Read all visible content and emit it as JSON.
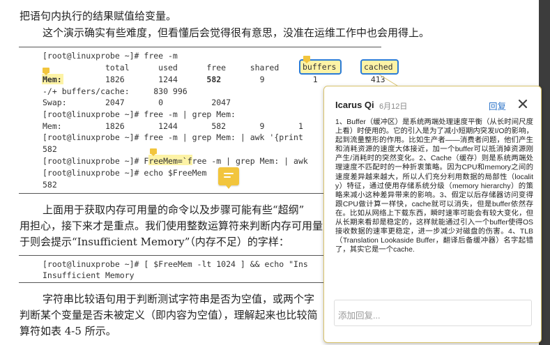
{
  "document": {
    "para1_line1": "把语句内执行的结果赋值给变量。",
    "para1_line2": "这个演示确实有些难度，但看懂后会觉得很有意思，没准在运维工作中也会用得上。",
    "code1": {
      "prompt": "[root@linuxprobe ~]# free -m",
      "header": "             total      used      free     shared     buffers     cached",
      "mem_label": "Mem:",
      "mem_values": "         1826       1244      ",
      "mem_free": "582",
      "mem_rest": "        9          1           413",
      "buffers_cache": "-/+ buffers/cache:     830 996",
      "swap": "Swap:        2047       0          2047",
      "grep_cmd": "[root@linuxprobe ~]# free -m | grep Mem:",
      "grep_out": "Mem:         1826       1244       582       9       1        413",
      "awk_cmd": "[root@linuxprobe ~]# free -m | grep Mem: | awk '{print",
      "awk_out": "582",
      "assign_prompt": "[root@linuxprobe ~]# ",
      "assign_var": "FreeMem=",
      "assign_rest": "`free -m | grep Mem: | awk",
      "echo_cmd": "[root@linuxprobe ~]# echo $FreeMem",
      "echo_out": "582"
    },
    "para2_line1": "上面用于获取内存可用量的命令以及步骤可能有些“超纲”",
    "para2_line2": "用担心，接下来才是重点。我们使用整数运算符来判断内存可用量",
    "para2_line3": "于则会提示“Insufficient Memory”（内存不足）的字样：",
    "code2": {
      "line1": "[root@linuxprobe ~]# [ $FreeMem -lt 1024 ] && echo \"Ins",
      "line2": "Insufficient Memory"
    },
    "para3_line1": "字符串比较语句用于判断测试字符串是否为空值，或两个字",
    "para3_line2": "判断某个变量是否未被定义（即内容为空值），理解起来也比较简",
    "para3_line3": "算符如表 4-5 所示。"
  },
  "highlights": {
    "buffers": "buffers",
    "cached": "cached",
    "mem": "Mem:",
    "freemem": "FreeMem="
  },
  "comment": {
    "author": "Icarus Qi",
    "date": "6月12日",
    "reply_label": "回复",
    "body": "1、Buffer（缓冲区）是系统两端处理速度平衡（从长时间尺度上看）时使用的。它的引入是为了减小短期内突发I/O的影响，起到流量整形的作用。比如生产者——消费者问题，他们产生和消耗资源的速度大体接近，加一个buffer可以抵消掉资源刚产生/消耗时的突然变化。2、Cache（缓存）则是系统两端处理速度不匹配时的一种折衷策略。因为CPU和memory之间的速度差异越来越大，所以人们充分利用数据的局部性（locality）特征，通过使用存储系统分级（memory hierarchy）的策略来减小这种差异带来的影响。3、假定以后存储器访问变得跟CPU做计算一样快，cache就可以消失，但是buffer依然存在。比如从网络上下载东西，瞬时速率可能会有较大变化，但从长期来看却是稳定的，这样就能通过引入一个buffer使得OS接收数据的速率更稳定，进一步减少对磁盘的伤害。4、TLB（Translation Lookaside Buffer，翻译后备缓冲器）名字起错了，其实它是一个cache.",
    "reply_placeholder": "添加回复..."
  },
  "colors": {
    "highlight": "#fdf3a6",
    "outline": "#2a7bd6",
    "note_icon": "#f2c53d",
    "link": "#2a72c8"
  }
}
